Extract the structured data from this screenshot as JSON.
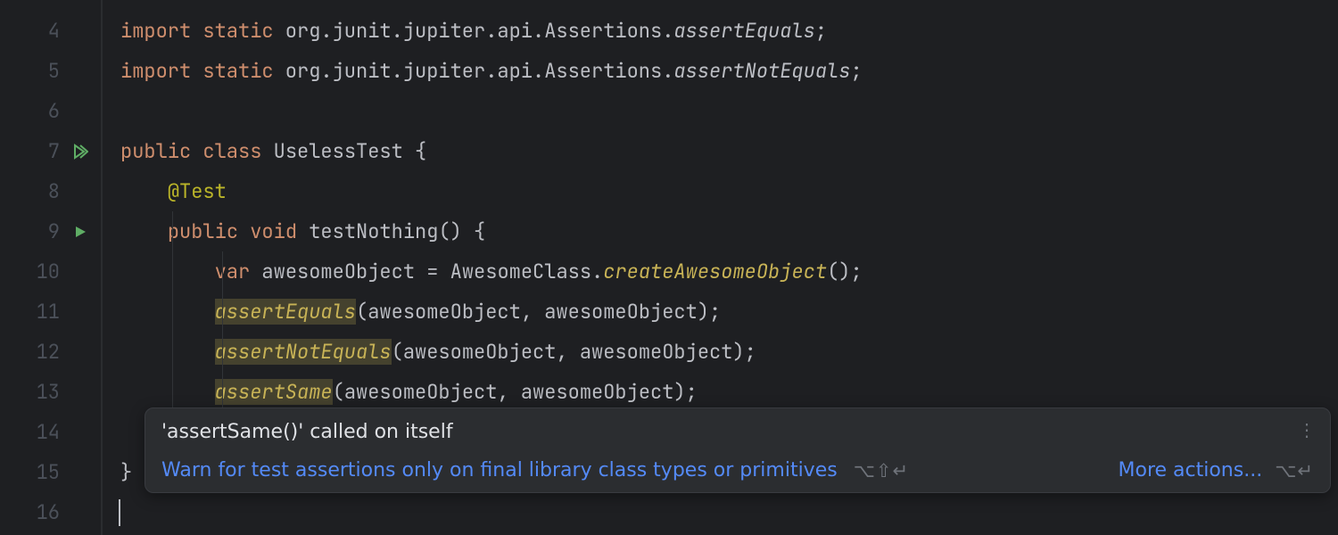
{
  "gutter": {
    "lines": [
      "4",
      "5",
      "6",
      "7",
      "8",
      "9",
      "10",
      "11",
      "12",
      "13",
      "14",
      "15",
      "16"
    ]
  },
  "code": {
    "line4": {
      "import": "import",
      "static": "static",
      "pkg": " org.junit.jupiter.api.Assertions.",
      "method": "assertEquals",
      "semi": ";"
    },
    "line5": {
      "import": "import",
      "static": "static",
      "pkg": " org.junit.jupiter.api.Assertions.",
      "method": "assertNotEquals",
      "semi": ";"
    },
    "line7": {
      "public": "public",
      "class": "class",
      "name": " UselessTest ",
      "brace": "{"
    },
    "line8": {
      "annotation": "@Test"
    },
    "line9": {
      "public": "public",
      "void": "void",
      "name": " testNothing",
      "paren": "() ",
      "brace": "{"
    },
    "line10": {
      "var": "var",
      "ident": " awesomeObject ",
      "eq": "=",
      "cls": " AwesomeClass.",
      "method": "createAwesomeObject",
      "rest": "();"
    },
    "line11": {
      "method": "assertEquals",
      "args": "(awesomeObject, awesomeObject);"
    },
    "line12": {
      "method": "assertNotEquals",
      "args": "(awesomeObject, awesomeObject);"
    },
    "line13": {
      "method": "assertSame",
      "args": "(awesomeObject, awesomeObject);"
    },
    "line15": {
      "brace": "}"
    }
  },
  "tooltip": {
    "title": "'assertSame()' called on itself",
    "fixText": "Warn for test assertions only on final library class types or primitives",
    "shortcut1": "⌥⇧↵",
    "moreActions": "More actions...",
    "shortcut2": "⌥↵"
  }
}
